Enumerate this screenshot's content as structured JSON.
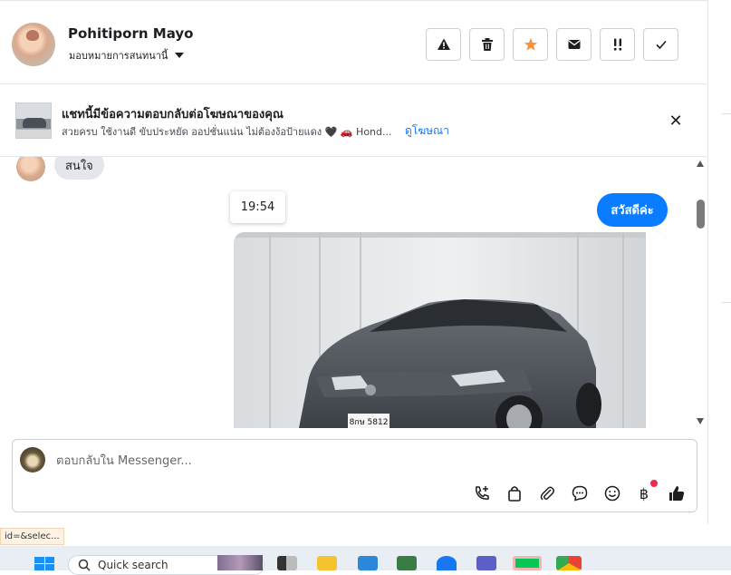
{
  "header": {
    "user_name": "Pohitiporn Mayo",
    "assign_label": "มอบหมายการสนทนานี้",
    "tools": [
      {
        "name": "spam-report",
        "icon": "warning-icon"
      },
      {
        "name": "delete",
        "icon": "trash-icon"
      },
      {
        "name": "star",
        "icon": "star-icon"
      },
      {
        "name": "mark-unread",
        "icon": "envelope-icon"
      },
      {
        "name": "follow-up",
        "icon": "priority-icon"
      },
      {
        "name": "done",
        "icon": "check-icon"
      }
    ],
    "star_color": "#f7923a"
  },
  "ad_banner": {
    "title": "แชทนี้มีข้อความตอบกลับต่อโฆษณาของคุณ",
    "description": "สวยครบ ใช้งานดี ขับประหยัด ออปชั่นแน่น ไม่ต้องง้อป้ายแดง 🖤 🚗 Hond...",
    "link": "ดูโฆษณา",
    "close": "✕"
  },
  "chat": {
    "incoming_text": "สนใจ",
    "timestamp": "19:54",
    "outgoing_text": "สวัสดีค่ะ",
    "image_plate": "8กษ 5812",
    "outgoing_color": "#0a7cff"
  },
  "composer": {
    "placeholder": "ตอบกลับใน Messenger...",
    "icons": [
      "call-add-icon",
      "bag-icon",
      "paperclip-icon",
      "chat-bubble-icon",
      "emoji-icon",
      "baht-icon",
      "thumbs-up-icon"
    ],
    "baht_symbol": "฿"
  },
  "status_bar": {
    "url_fragment": "id=&selec..."
  },
  "taskbar": {
    "search_placeholder": "Quick search"
  }
}
